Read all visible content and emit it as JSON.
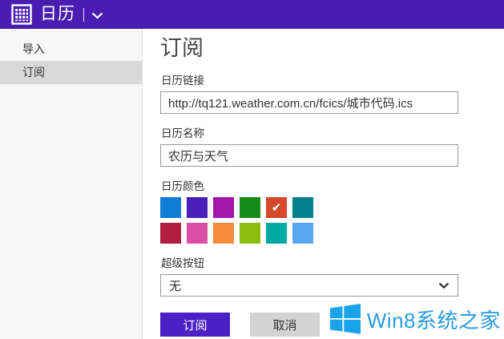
{
  "header": {
    "title": "日历",
    "accent_color": "#4A1DB2"
  },
  "sidebar": {
    "items": [
      {
        "label": "导入",
        "selected": false
      },
      {
        "label": "订阅",
        "selected": true
      }
    ]
  },
  "main": {
    "heading": "订阅",
    "fields": {
      "link": {
        "label": "日历链接",
        "value": "http://tq121.weather.com.cn/fcics/城市代码.ics"
      },
      "name": {
        "label": "日历名称",
        "value": "农历与天气"
      },
      "color": {
        "label": "日历颜色"
      },
      "charm": {
        "label": "超级按钮",
        "value": "无"
      }
    },
    "color_picker": {
      "check_glyph": "✔",
      "rows": [
        [
          {
            "hex": "#0F7DD7"
          },
          {
            "hex": "#4A1EB8"
          },
          {
            "hex": "#A217A8"
          },
          {
            "hex": "#178A17"
          },
          {
            "hex": "#D3492A",
            "selected": true
          },
          {
            "hex": "#06808D"
          }
        ],
        [
          {
            "hex": "#B11E3F"
          },
          {
            "hex": "#DB4EA5"
          },
          {
            "hex": "#F68C3B"
          },
          {
            "hex": "#8CBD10"
          },
          {
            "hex": "#00A9A1"
          },
          {
            "hex": "#5BA6F2"
          }
        ]
      ]
    },
    "buttons": {
      "subscribe": "订阅",
      "cancel": "取消"
    }
  },
  "watermark": {
    "text": "Win8系统之家",
    "logo_color": "#1AA3E8"
  }
}
